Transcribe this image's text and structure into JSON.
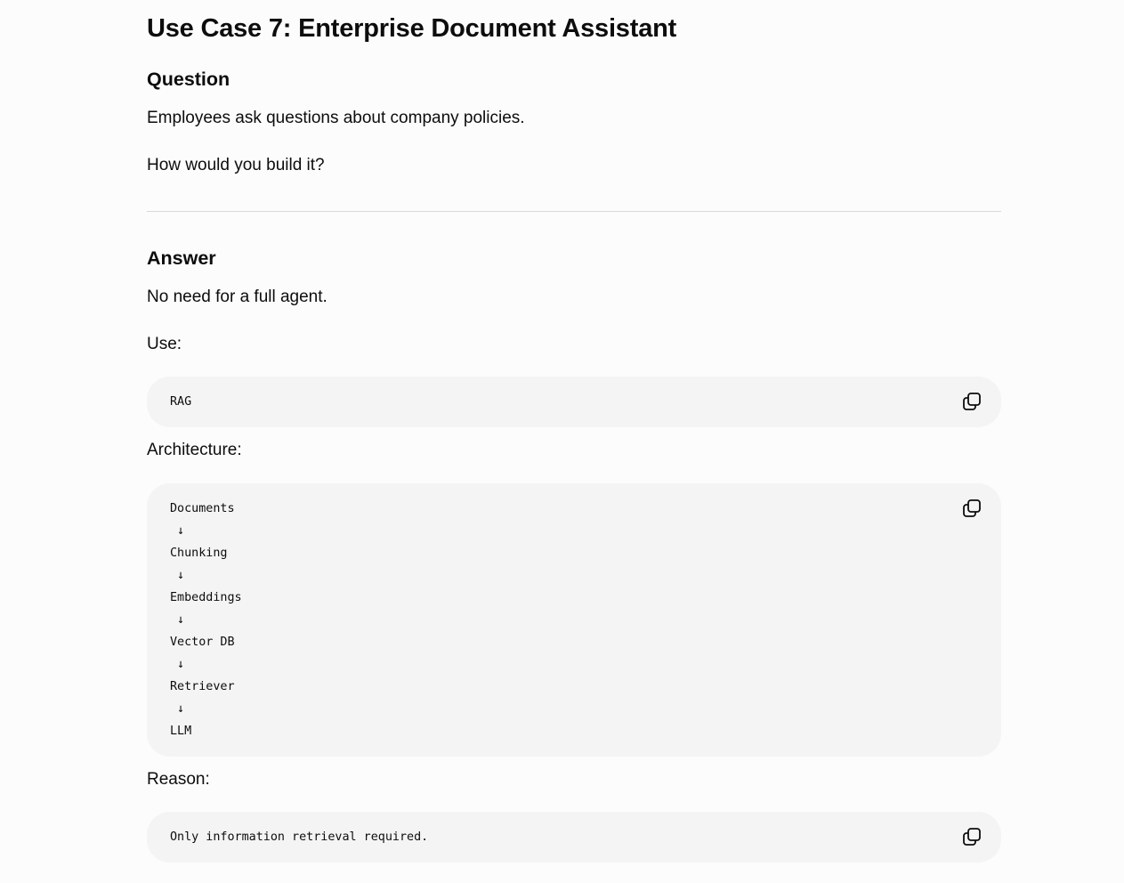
{
  "page": {
    "title": "Use Case 7: Enterprise Document Assistant"
  },
  "question": {
    "heading": "Question",
    "paragraphs": [
      "Employees ask questions about company policies.",
      "How would you build it?"
    ]
  },
  "answer": {
    "heading": "Answer",
    "intro": "No need for a full agent.",
    "use_label": "Use:",
    "use_code": [
      "RAG"
    ],
    "architecture_label": "Architecture:",
    "architecture_code": [
      "Documents",
      " ↓",
      "Chunking",
      " ↓",
      "Embeddings",
      " ↓",
      "Vector DB",
      " ↓",
      "Retriever",
      " ↓",
      "LLM"
    ],
    "reason_label": "Reason:",
    "reason_code": [
      "Only information retrieval required."
    ]
  },
  "icons": {
    "copy": "copy-icon"
  },
  "colors": {
    "background": "#fcfcfc",
    "code_background": "#f4f4f4",
    "text": "#0d0d0d",
    "divider": "#d8d8d8"
  }
}
